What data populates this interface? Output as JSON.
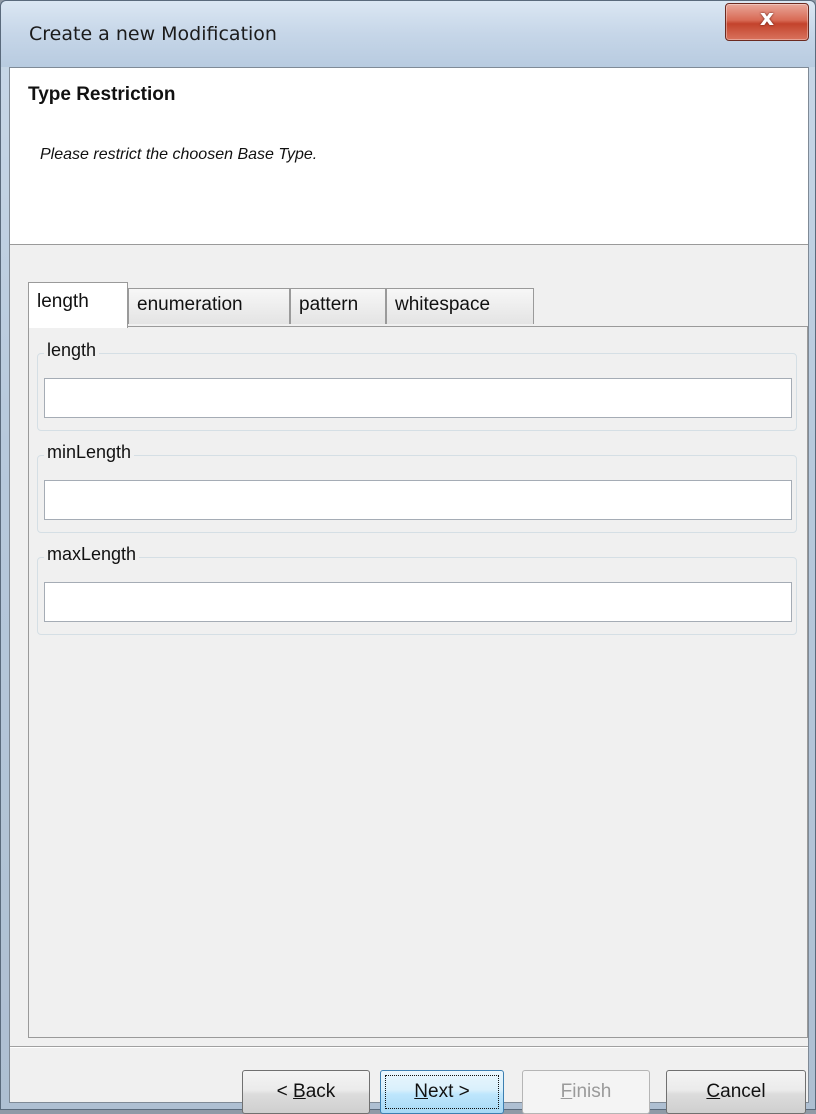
{
  "window": {
    "title": "Create a new Modification",
    "close_glyph": "x"
  },
  "header": {
    "title": "Type Restriction",
    "description": "Please restrict the choosen Base Type."
  },
  "tabs": [
    {
      "label": "length",
      "active": true
    },
    {
      "label": "enumeration",
      "active": false
    },
    {
      "label": "pattern",
      "active": false
    },
    {
      "label": "whitespace",
      "active": false
    }
  ],
  "fields": [
    {
      "label": "length",
      "value": ""
    },
    {
      "label": "minLength",
      "value": ""
    },
    {
      "label": "maxLength",
      "value": ""
    }
  ],
  "buttons": {
    "back": {
      "prefix": "< ",
      "mnemonic": "B",
      "rest": "ack"
    },
    "next": {
      "mnemonic": "N",
      "rest": "ext >"
    },
    "finish": {
      "mnemonic": "F",
      "rest": "inish",
      "disabled": true
    },
    "cancel": {
      "mnemonic": "C",
      "rest": "ancel"
    }
  },
  "icons": {
    "close": "close-icon"
  }
}
